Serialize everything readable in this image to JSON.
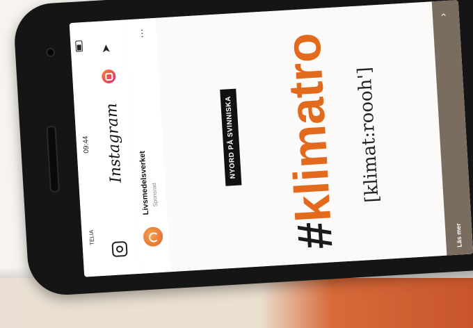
{
  "status_bar": {
    "time": "09:44",
    "carrier": "TELIA"
  },
  "instagram_header": {
    "logo": "Instagram",
    "icons": [
      "camera-icon",
      "igtv-icon",
      "send-icon"
    ]
  },
  "post": {
    "account_name": "Livsmedelsverket",
    "account_subtitle": "Sponsrad",
    "badge": "NYORD PÅ SVINNISKA",
    "hashtag_symbol": "#",
    "hashtag_word": "klimatro",
    "pronunciation": "[klimat:roooh']",
    "cta": "Läs mer"
  },
  "colors": {
    "accent": "#e36a1d",
    "cta_bar": "#7a6d60",
    "badge_bg": "#111111"
  }
}
